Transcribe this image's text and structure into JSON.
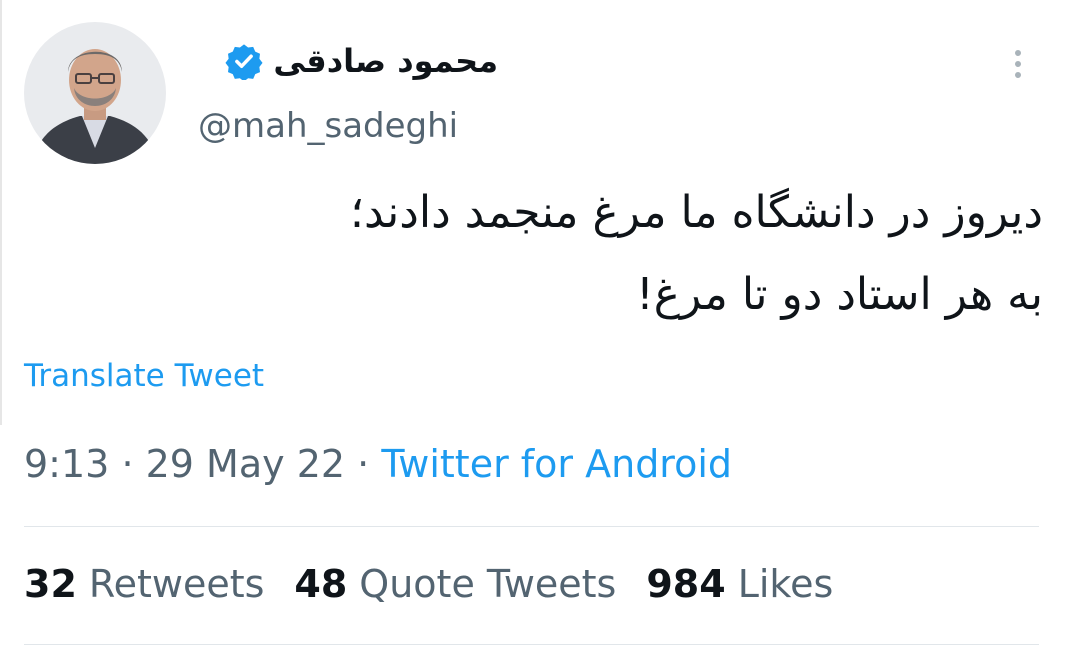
{
  "author": {
    "name": "محمود صادقی",
    "handle": "@mah_sadeghi",
    "verified_color": "#1d9bf0"
  },
  "tweet": {
    "lines": [
      "دیروز در دانشگاه ما مرغ منجمد دادند؛",
      "به هر استاد دو تا مرغ!"
    ],
    "translate_label": "Translate Tweet"
  },
  "meta": {
    "time": "9:13",
    "separator": "·",
    "date": "29 May 22",
    "source": "Twitter for Android"
  },
  "stats": {
    "retweets_count": "32",
    "retweets_label": "Retweets",
    "quotes_count": "48",
    "quotes_label": "Quote Tweets",
    "likes_count": "984",
    "likes_label": "Likes"
  },
  "colors": {
    "link": "#1d9bf0",
    "secondary_text": "#536471",
    "primary_text": "#0f1419"
  },
  "icons": {
    "more": "more-vertical-icon",
    "verified": "verified-badge-icon"
  }
}
